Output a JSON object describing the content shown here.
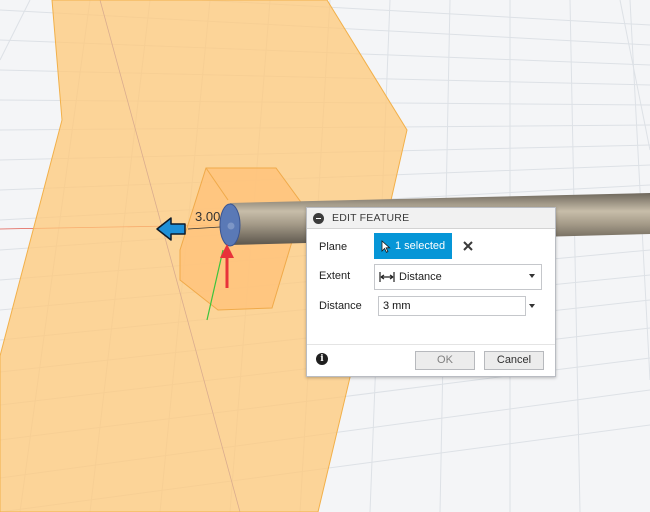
{
  "viewport": {
    "dimension_label": "3.00"
  },
  "dialog": {
    "title": "EDIT FEATURE",
    "plane": {
      "label": "Plane",
      "selection_text": "1 selected"
    },
    "extent": {
      "label": "Extent",
      "value": "Distance"
    },
    "distance": {
      "label": "Distance",
      "value": "3 mm"
    },
    "ok_label": "OK",
    "cancel_label": "Cancel",
    "info_glyph": "i"
  },
  "colors": {
    "plane_fill": "#ffc878",
    "plane_edge": "#f2b04a",
    "rod": "#8c8374",
    "select_blue": "#0696d7",
    "arrow_red": "#e8333a",
    "arrow_blue": "#1e90d8"
  },
  "icons": [
    "collapse-icon",
    "cursor-arrow-icon",
    "clear-x-icon",
    "distance-extent-icon",
    "info-icon",
    "chevron-down-icon",
    "manipulator-arrow-icon"
  ]
}
